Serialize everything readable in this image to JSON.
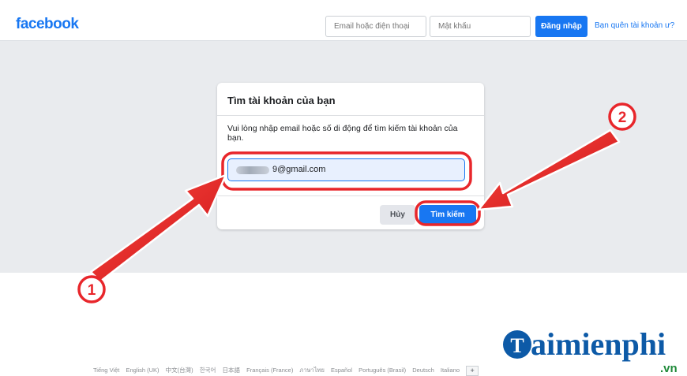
{
  "header": {
    "logo": "facebook",
    "email_placeholder": "Email hoặc điện thoại",
    "password_placeholder": "Mật khẩu",
    "login_button": "Đăng nhập",
    "forgot_link": "Bạn quên tài khoản ư?"
  },
  "dialog": {
    "title": "Tìm tài khoản của bạn",
    "description": "Vui lòng nhập email hoặc số di động để tìm kiếm tài khoản của bạn.",
    "email_value": "9@gmail.com",
    "cancel_button": "Hủy",
    "search_button": "Tìm kiếm"
  },
  "annotations": {
    "marker_1": "1",
    "marker_2": "2",
    "color": "#e8262b"
  },
  "footer": {
    "languages": [
      "Tiếng Việt",
      "English (UK)",
      "中文(台灣)",
      "한국어",
      "日本語",
      "Français (France)",
      "ภาษาไทย",
      "Español",
      "Português (Brasil)",
      "Deutsch",
      "Italiano"
    ],
    "more_button": "+"
  },
  "watermark": {
    "brand": "aimienphi",
    "suffix": ".vn"
  },
  "colors": {
    "brand_blue": "#1877f2",
    "page_gray": "#e9ebee",
    "annotation_red": "#e8262b"
  }
}
